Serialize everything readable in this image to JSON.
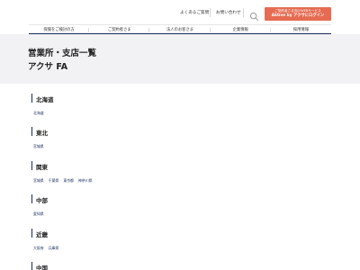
{
  "header": {
    "faq_label": "よくあるご質問",
    "contact_label": "お問い合わせ",
    "search_icon": "search-icon",
    "cta": {
      "sub": "ご契約者さま向けWEBサービス",
      "main": "Aktive by アクサにログイン"
    }
  },
  "nav": {
    "items": [
      {
        "label": "保険をご検討の方"
      },
      {
        "label": "ご契約者さま"
      },
      {
        "label": "法人のお客さま"
      },
      {
        "label": "企業情報"
      },
      {
        "label": "採用情報"
      }
    ]
  },
  "page": {
    "title": "営業所・支店一覧",
    "subtitle": "アクサ FA"
  },
  "regions": [
    {
      "name": "北海道",
      "links": [
        "北海道"
      ]
    },
    {
      "name": "東北",
      "links": [
        "宮城県"
      ]
    },
    {
      "name": "関東",
      "links": [
        "宮城県",
        "千葉県",
        "東京都",
        "神奈川県"
      ]
    },
    {
      "name": "中部",
      "links": [
        "愛知県"
      ]
    },
    {
      "name": "近畿",
      "links": [
        "大阪府",
        "兵庫県"
      ]
    },
    {
      "name": "中国",
      "links": []
    }
  ],
  "colors": {
    "accent_navy": "#1a2a5c",
    "cta_orange": "#e56c52",
    "hero_bg": "#f2f2f5"
  }
}
